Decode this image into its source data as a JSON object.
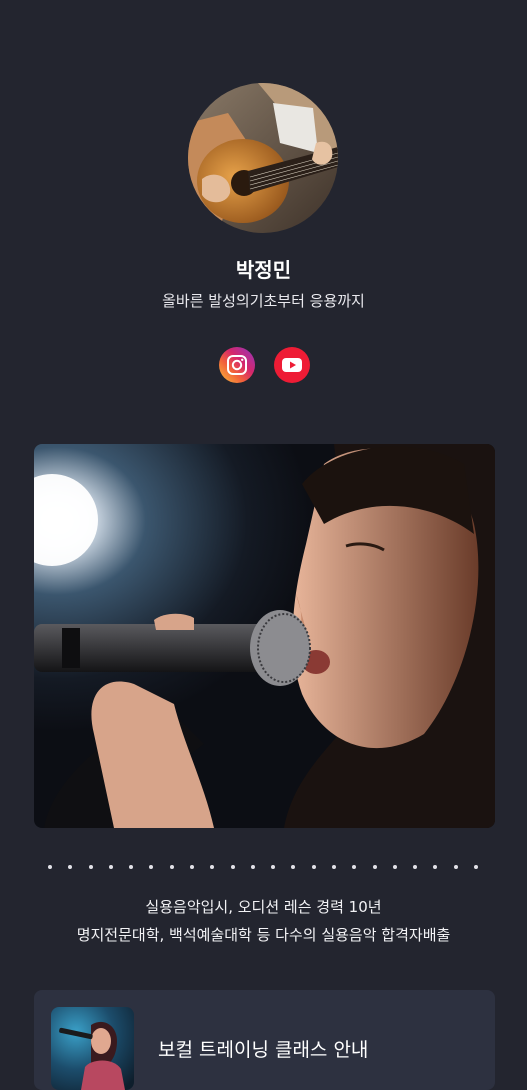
{
  "profile": {
    "name": "박정민",
    "tagline": "올바른 발성의기초부터 응용까지"
  },
  "social": [
    {
      "name": "instagram-icon"
    },
    {
      "name": "youtube-icon"
    }
  ],
  "bio": {
    "line1": "실용음악입시, 오디션 레슨 경력 10년",
    "line2": "명지전문대학, 백석예술대학 등 다수의 실용음악 합격자배출"
  },
  "links": [
    {
      "title": "보컬 트레이닝 클래스 안내"
    }
  ],
  "colors": {
    "background": "#23252f",
    "card": "#2d3140",
    "youtube": "#ee1c35"
  }
}
